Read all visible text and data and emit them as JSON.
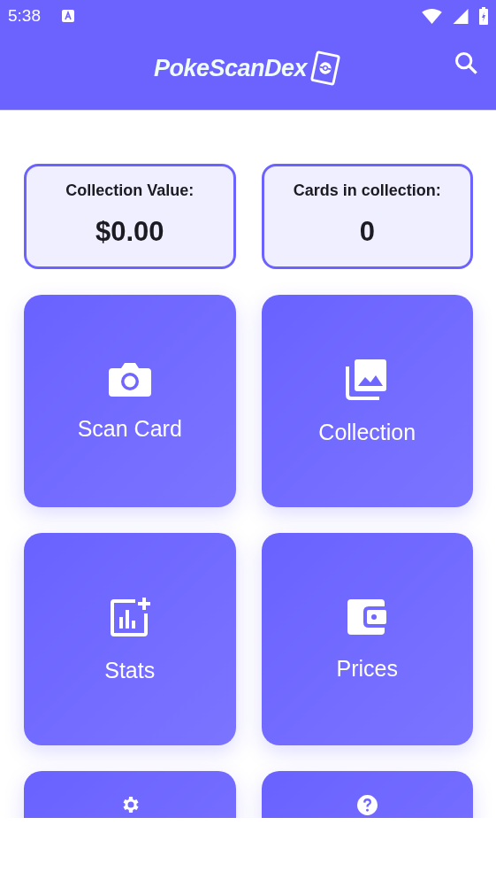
{
  "status_bar": {
    "time": "5:38"
  },
  "app_bar": {
    "title": "PokeScanDex"
  },
  "stats": [
    {
      "label": "Collection Value:",
      "value": "$0.00"
    },
    {
      "label": "Cards in collection:",
      "value": "0"
    }
  ],
  "tiles": [
    {
      "kind": "camera",
      "label": "Scan Card"
    },
    {
      "kind": "gallery",
      "label": "Collection"
    },
    {
      "kind": "stats",
      "label": "Stats"
    },
    {
      "kind": "wallet",
      "label": "Prices"
    },
    {
      "kind": "settings"
    },
    {
      "kind": "help"
    }
  ]
}
